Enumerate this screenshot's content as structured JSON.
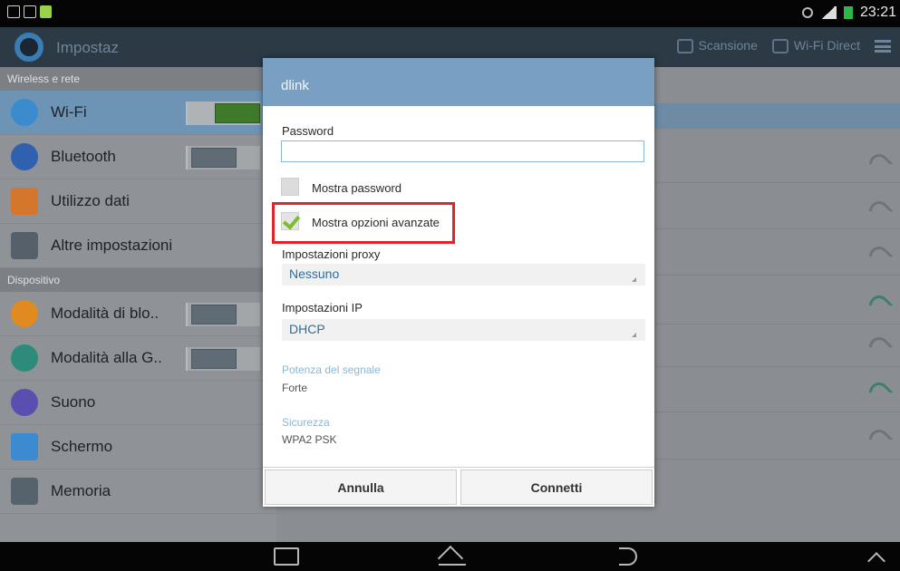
{
  "status_bar": {
    "time": "23:21"
  },
  "action_bar": {
    "title": "Impostaz",
    "scan_label": "Scansione",
    "wifi_direct_label": "Wi-Fi Direct"
  },
  "sidebar": {
    "section_wireless": "Wireless e rete",
    "section_device": "Dispositivo",
    "items": [
      {
        "label": "Wi-Fi",
        "icon": "wifi-icon",
        "color": "#3b8ccf"
      },
      {
        "label": "Bluetooth",
        "icon": "bluetooth-icon",
        "color": "#3060b0"
      },
      {
        "label": "Utilizzo dati",
        "icon": "data-usage-icon",
        "color": "#d4762b"
      },
      {
        "label": "Altre impostazioni",
        "icon": "more-settings-icon",
        "color": "#55606a"
      },
      {
        "label": "Modalità di blo..",
        "icon": "blocking-mode-icon",
        "color": "#e08a1f"
      },
      {
        "label": "Modalità alla G..",
        "icon": "driving-mode-icon",
        "color": "#2e8a7a"
      },
      {
        "label": "Suono",
        "icon": "sound-icon",
        "color": "#5a4fb0"
      },
      {
        "label": "Schermo",
        "icon": "display-icon",
        "color": "#3c8bd0"
      },
      {
        "label": "Memoria",
        "icon": "storage-icon",
        "color": "#56636c"
      }
    ]
  },
  "dialog": {
    "title": "dlink",
    "password_label": "Password",
    "password_value": "",
    "show_password_label": "Mostra password",
    "advanced_label": "Mostra opzioni avanzate",
    "proxy_label": "Impostazioni proxy",
    "proxy_value": "Nessuno",
    "ip_label": "Impostazioni IP",
    "ip_value": "DHCP",
    "signal_label": "Potenza del segnale",
    "signal_value": "Forte",
    "security_label": "Sicurezza",
    "security_value": "WPA2 PSK",
    "cancel_label": "Annulla",
    "connect_label": "Connetti"
  }
}
